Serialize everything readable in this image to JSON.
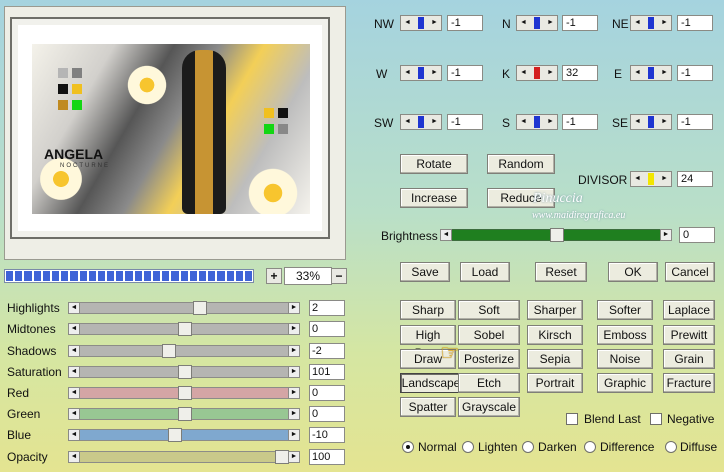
{
  "preview": {
    "title_main": "ANGELA",
    "title_sub": "NOCTURNE",
    "zoom": {
      "value": "33%",
      "plus": "+",
      "minus": "−",
      "progress": 1.0
    }
  },
  "adjustments": [
    {
      "label": "Highlights",
      "value": "2",
      "position": 0.58,
      "track_color": "#b5b5b2"
    },
    {
      "label": "Midtones",
      "value": "0",
      "position": 0.5,
      "track_color": "#b5b5b2"
    },
    {
      "label": "Shadows",
      "value": "-2",
      "position": 0.42,
      "track_color": "#b5b5b2"
    },
    {
      "label": "Saturation",
      "value": "101",
      "position": 0.5,
      "track_color": "#b5b5b2"
    },
    {
      "label": "Red",
      "value": "0",
      "position": 0.5,
      "track_color": "#d4a5a5"
    },
    {
      "label": "Green",
      "value": "0",
      "position": 0.5,
      "track_color": "#98c793"
    },
    {
      "label": "Blue",
      "value": "-10",
      "position": 0.45,
      "track_color": "#7fa8cf"
    },
    {
      "label": "Opacity",
      "value": "100",
      "position": 1.0,
      "track_color": "#c9c98a"
    }
  ],
  "matrix": [
    {
      "label": "NW",
      "value": "-1",
      "marker_color": "#1f35d1"
    },
    {
      "label": "N",
      "value": "-1",
      "marker_color": "#1f35d1"
    },
    {
      "label": "NE",
      "value": "-1",
      "marker_color": "#1f35d1"
    },
    {
      "label": "W",
      "value": "-1",
      "marker_color": "#1f35d1"
    },
    {
      "label": "K",
      "value": "32",
      "marker_color": "#d42020"
    },
    {
      "label": "E",
      "value": "-1",
      "marker_color": "#1f35d1"
    },
    {
      "label": "SW",
      "value": "-1",
      "marker_color": "#1f35d1"
    },
    {
      "label": "S",
      "value": "-1",
      "marker_color": "#1f35d1"
    },
    {
      "label": "SE",
      "value": "-1",
      "marker_color": "#1f35d1"
    }
  ],
  "actions": {
    "rotate": "Rotate",
    "random": "Random",
    "increase": "Increase",
    "reduce": "Reduce"
  },
  "divisor": {
    "label": "DIVISOR",
    "value": "24",
    "marker_color": "#f2e600"
  },
  "watermark": {
    "line1": "Pinuccia",
    "line2": "www.maidiregrafica.eu"
  },
  "brightness": {
    "label": "Brightness",
    "value": "0",
    "level": 0.5,
    "track_color": "#1f7f1f"
  },
  "file_buttons": {
    "save": "Save",
    "load": "Load",
    "reset": "Reset",
    "ok": "OK",
    "cancel": "Cancel"
  },
  "presets": [
    [
      "Sharp",
      "Soft",
      "Sharper",
      "Softer",
      "Laplace"
    ],
    [
      "High Pass",
      "Sobel",
      "Kirsch",
      "Emboss",
      "Prewitt"
    ],
    [
      "Draw",
      "Posterize",
      "Sepia",
      "Noise",
      "Grain"
    ],
    [
      "Landscape",
      "Etch",
      "Portrait",
      "Graphic",
      "Fracture"
    ],
    [
      "Spatter",
      "Grayscale"
    ]
  ],
  "checkboxes": {
    "blend_last": "Blend Last",
    "negative": "Negative"
  },
  "blend_modes": [
    "Normal",
    "Lighten",
    "Darken",
    "Difference",
    "Diffuse"
  ],
  "selected_blend_mode": "Normal",
  "selected_preset": "Landscape",
  "icons": {
    "left_arrow": "◄",
    "right_arrow": "►",
    "hand_cursor": "☞"
  }
}
